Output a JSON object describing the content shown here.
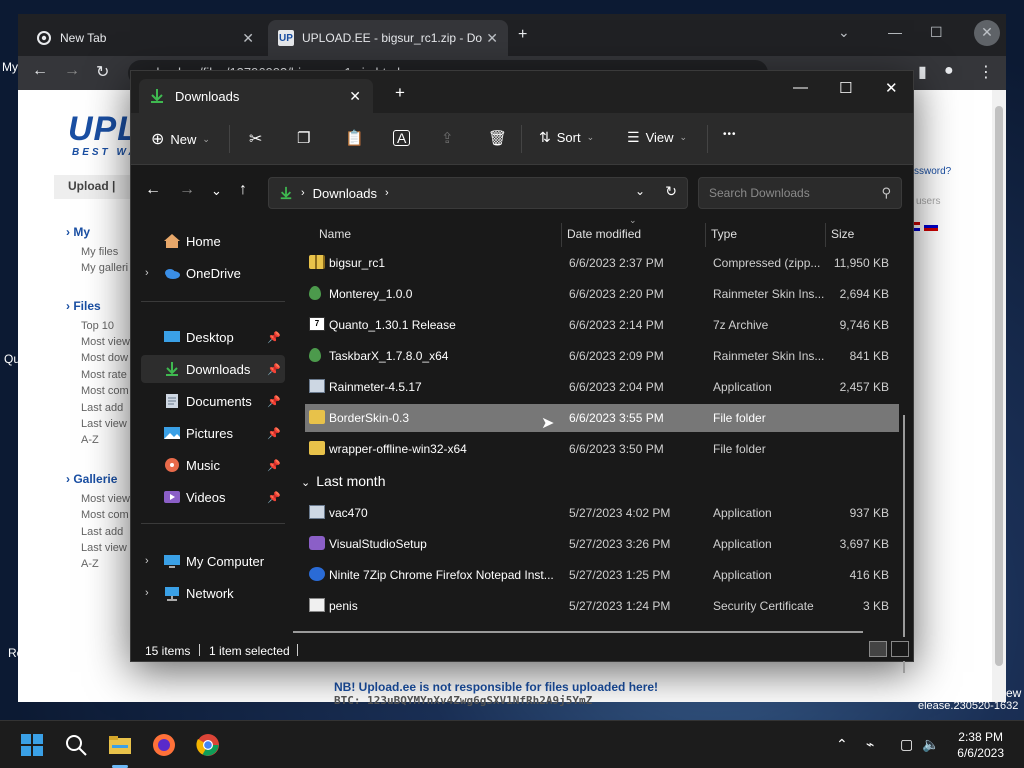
{
  "desktop": {
    "frag_my": "My",
    "frag_q": "Qu",
    "frag_re": "Re",
    "frag_ew": "ew",
    "build": "elease.230520-1632"
  },
  "chrome": {
    "tabs": [
      {
        "label": "New Tab",
        "icon": "chrome-icon"
      },
      {
        "label": "UPLOAD.EE - bigsur_rc1.zip - Dow",
        "icon": "upload-ee-icon"
      }
    ],
    "url": "upload.ee/files/13796993/bigsur_rc1.zip.html"
  },
  "webpage": {
    "logo": "UPL",
    "logo_sub": "BEST WA",
    "nav_upload": "Upload  |",
    "sections": [
      {
        "title": "My",
        "links": [
          "My files",
          "My galleri"
        ]
      },
      {
        "title": "Files",
        "links": [
          "Top 10",
          "Most view",
          "Most dow",
          "Most rate",
          "Most com",
          "Last add",
          "Last view",
          "A-Z"
        ]
      },
      {
        "title": "Gallerie",
        "links": [
          "Most view",
          "Most com",
          "Last add",
          "Last view",
          "A-Z"
        ]
      }
    ],
    "frag_password": "ssword?",
    "frag_users": "users",
    "notice": "NB! Upload.ee is not responsible for files uploaded here!",
    "btc": "BTC: 123uBQYMYnXv4Zwg6gSXV1NfRh2A9j5YmZ"
  },
  "explorer": {
    "tab_title": "Downloads",
    "commands": {
      "new": "New",
      "sort": "Sort",
      "view": "View",
      "more": "•••"
    },
    "breadcrumb": "Downloads",
    "search_placeholder": "Search Downloads",
    "nav": [
      {
        "label": "Home",
        "icon": "home-icon"
      },
      {
        "label": "OneDrive",
        "icon": "onedrive-icon"
      },
      {
        "label": "Desktop",
        "icon": "desktop-icon"
      },
      {
        "label": "Downloads",
        "icon": "download-icon"
      },
      {
        "label": "Documents",
        "icon": "documents-icon"
      },
      {
        "label": "Pictures",
        "icon": "pictures-icon"
      },
      {
        "label": "Music",
        "icon": "music-icon"
      },
      {
        "label": "Videos",
        "icon": "videos-icon"
      },
      {
        "label": "My Computer",
        "icon": "computer-icon"
      },
      {
        "label": "Network",
        "icon": "network-icon"
      }
    ],
    "columns": {
      "name": "Name",
      "date": "Date modified",
      "type": "Type",
      "size": "Size"
    },
    "files": [
      {
        "name": "bigsur_rc1",
        "date": "6/6/2023 2:37 PM",
        "type": "Compressed (zipp...",
        "size": "11,950 KB",
        "icon": "zip-icon"
      },
      {
        "name": "Monterey_1.0.0",
        "date": "6/6/2023 2:20 PM",
        "type": "Rainmeter Skin Ins...",
        "size": "2,694 KB",
        "icon": "rainmeter-skin-icon"
      },
      {
        "name": "Quanto_1.30.1 Release",
        "date": "6/6/2023 2:14 PM",
        "type": "7z Archive",
        "size": "9,746 KB",
        "icon": "7z-icon"
      },
      {
        "name": "TaskbarX_1.7.8.0_x64",
        "date": "6/6/2023 2:09 PM",
        "type": "Rainmeter Skin Ins...",
        "size": "841 KB",
        "icon": "rainmeter-skin-icon"
      },
      {
        "name": "Rainmeter-4.5.17",
        "date": "6/6/2023 2:04 PM",
        "type": "Application",
        "size": "2,457 KB",
        "icon": "app-icon"
      },
      {
        "name": "BorderSkin-0.3",
        "date": "6/6/2023 3:55 PM",
        "type": "File folder",
        "size": "",
        "icon": "folder-icon"
      },
      {
        "name": "wrapper-offline-win32-x64",
        "date": "6/6/2023 3:50 PM",
        "type": "File folder",
        "size": "",
        "icon": "folder-icon"
      }
    ],
    "group_last_month": "Last month",
    "files_last_month": [
      {
        "name": "vac470",
        "date": "5/27/2023 4:02 PM",
        "type": "Application",
        "size": "937 KB",
        "icon": "app-icon"
      },
      {
        "name": "VisualStudioSetup",
        "date": "5/27/2023 3:26 PM",
        "type": "Application",
        "size": "3,697 KB",
        "icon": "visual-studio-icon"
      },
      {
        "name": "Ninite 7Zip Chrome Firefox Notepad Inst...",
        "date": "5/27/2023 1:25 PM",
        "type": "Application",
        "size": "416 KB",
        "icon": "ninite-icon"
      },
      {
        "name": "penis",
        "date": "5/27/2023 1:24 PM",
        "type": "Security Certificate",
        "size": "3 KB",
        "icon": "certificate-icon"
      }
    ],
    "status": {
      "count": "15 items",
      "selected": "1 item selected"
    }
  },
  "taskbar": {
    "time": "2:38 PM",
    "date": "6/6/2023"
  },
  "colors": {
    "explorer_bg": "#191919",
    "selection": "#777777",
    "upload_blue": "#1a4fa3",
    "taskbar": "#1c1c1c"
  }
}
